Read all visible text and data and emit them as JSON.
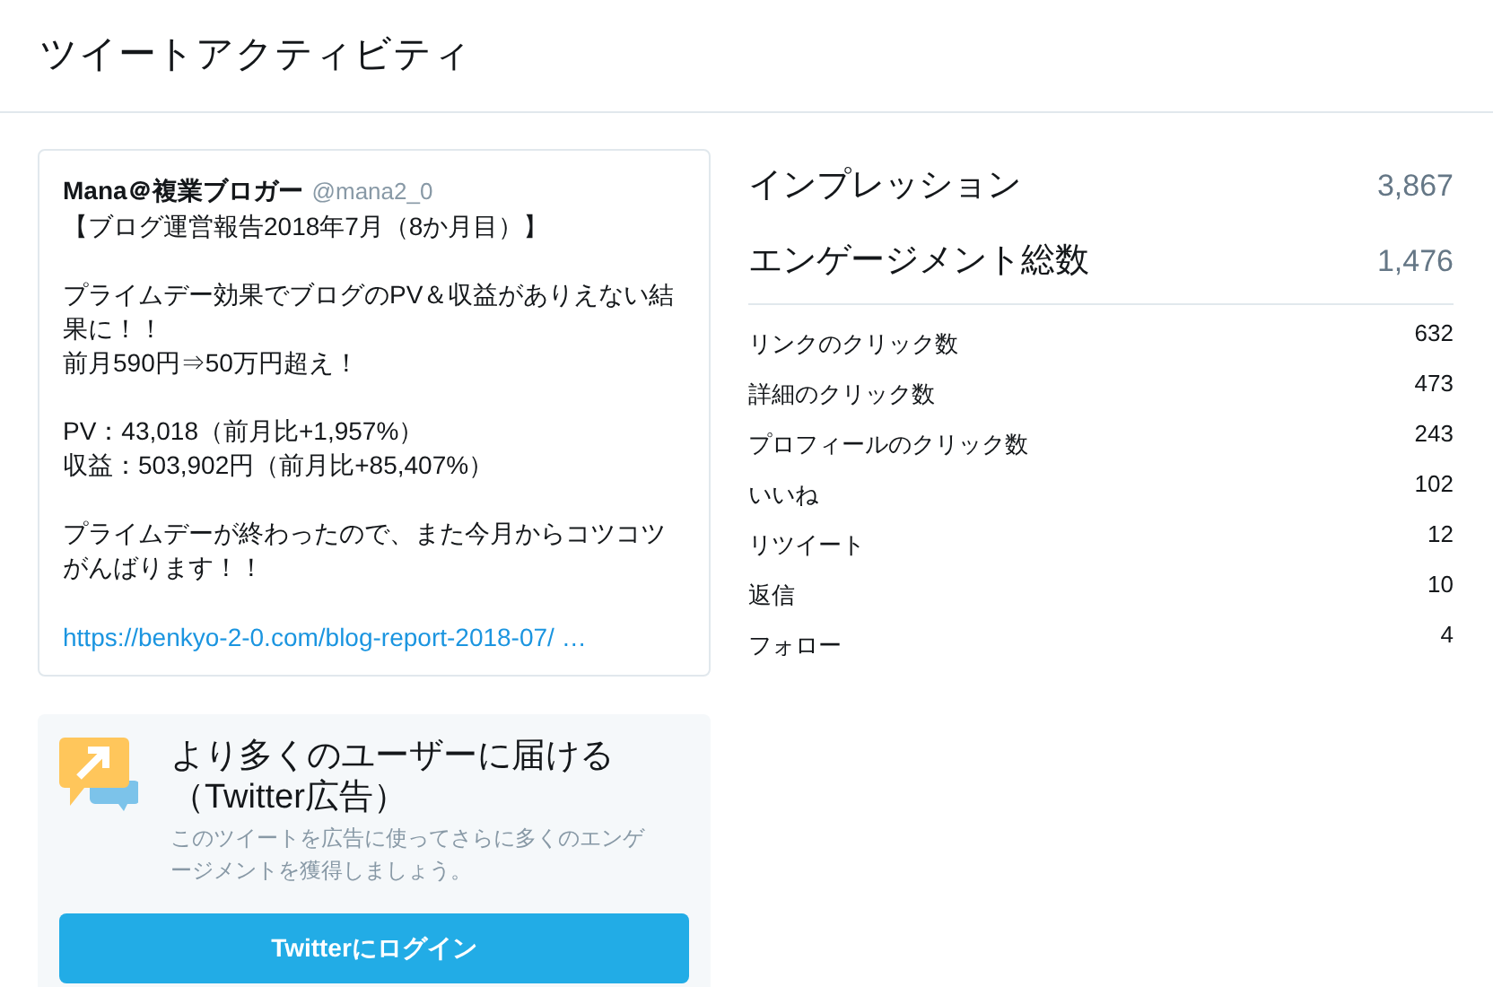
{
  "title": "ツイートアクティビティ",
  "tweet": {
    "name": "Mana＠複業ブロガー",
    "handle": "@mana2_0",
    "paragraphs": [
      [
        "【ブログ運営報告2018年7月（8か月目）】"
      ],
      [
        "プライムデー効果でブログのPV＆収益がありえない結果に！！",
        "前月590円⇒50万円超え！"
      ],
      [
        "PV：43,018（前月比+1,957%）",
        "収益：503,902円（前月比+85,407%）"
      ],
      [
        "プライムデーが終わったので、また今月からコツコツがんばります！！"
      ]
    ],
    "link": "https://benkyo-2-0.com/blog-report-2018-07/ …"
  },
  "promo": {
    "title": "より多くのユーザーに届ける（Twitter広告）",
    "description": "このツイートを広告に使ってさらに多くのエンゲージメントを獲得しましょう。",
    "button": "Twitterにログイン"
  },
  "totals": [
    {
      "label": "インプレッション",
      "value": "3,867"
    },
    {
      "label": "エンゲージメント総数",
      "value": "1,476"
    }
  ],
  "metrics": [
    {
      "label": "リンクのクリック数",
      "value": "632"
    },
    {
      "label": "詳細のクリック数",
      "value": "473"
    },
    {
      "label": "プロフィールのクリック数",
      "value": "243"
    },
    {
      "label": "いいね",
      "value": "102"
    },
    {
      "label": "リツイート",
      "value": "12"
    },
    {
      "label": "返信",
      "value": "10"
    },
    {
      "label": "フォロー",
      "value": "4"
    }
  ]
}
